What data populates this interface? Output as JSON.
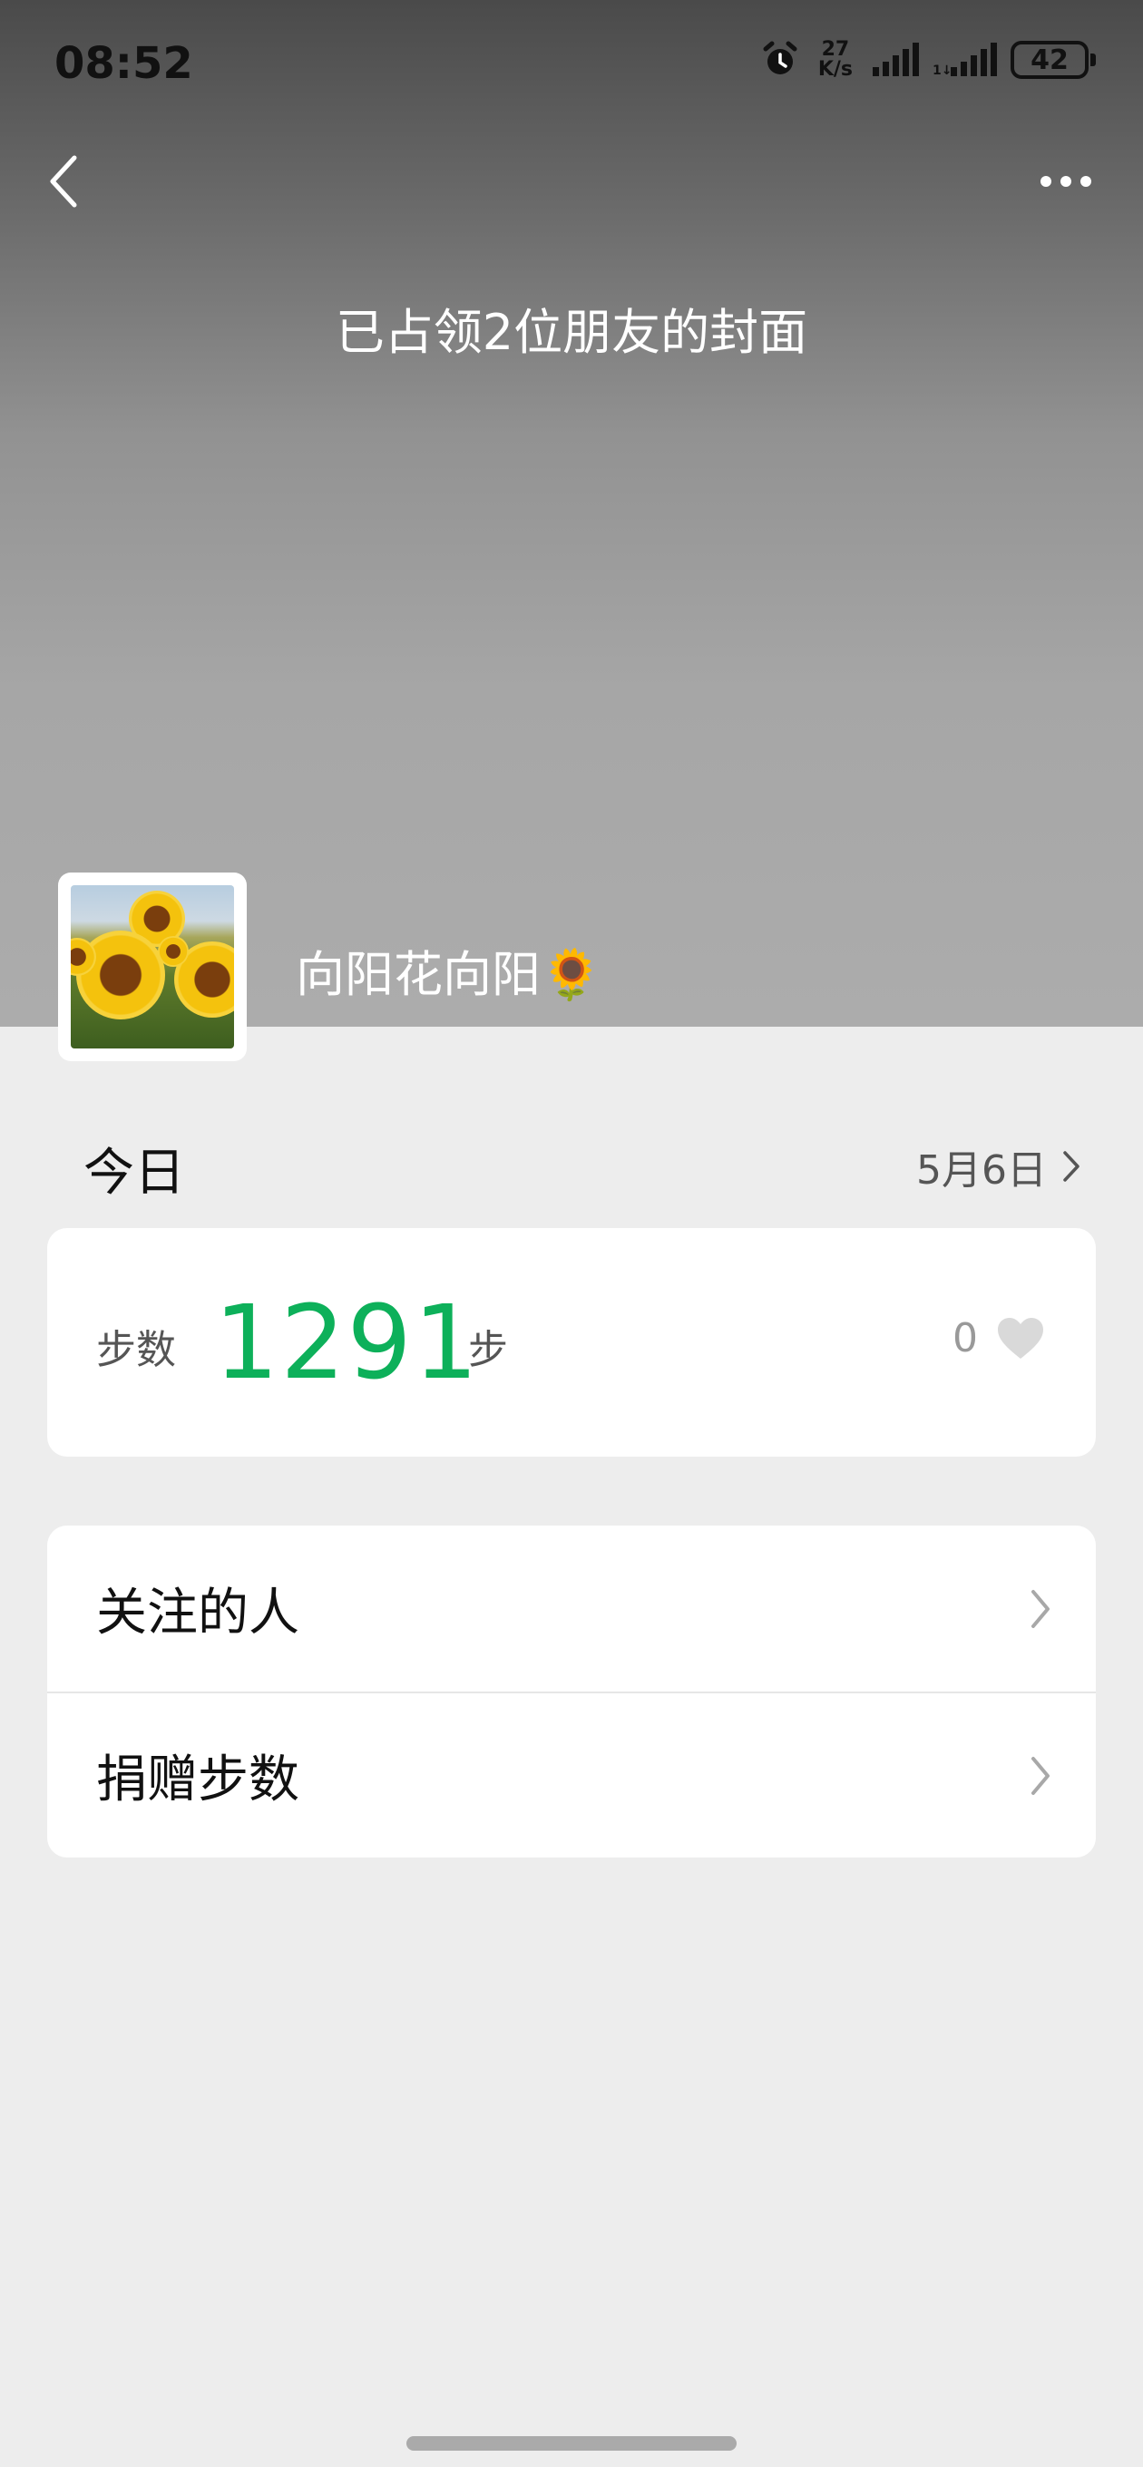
{
  "status_bar": {
    "time": "08:52",
    "net_speed_value": "27",
    "net_speed_unit": "K/s",
    "battery": "42",
    "icons": [
      "alarm-icon",
      "signal-icon",
      "signal-icon"
    ]
  },
  "nav": {
    "back_icon": "chevron-left-icon",
    "more_icon": "more-dots-icon"
  },
  "cover": {
    "title": "已占领2位朋友的封面"
  },
  "profile": {
    "nickname": "向阳花向阳🌻"
  },
  "today": {
    "label": "今日",
    "date_link": "5月6日"
  },
  "steps": {
    "label": "步数",
    "value": "1291",
    "unit": "步",
    "likes": "0",
    "accent_color": "#0db05a"
  },
  "menu": {
    "items": [
      {
        "label": "关注的人"
      },
      {
        "label": "捐赠步数"
      }
    ]
  }
}
